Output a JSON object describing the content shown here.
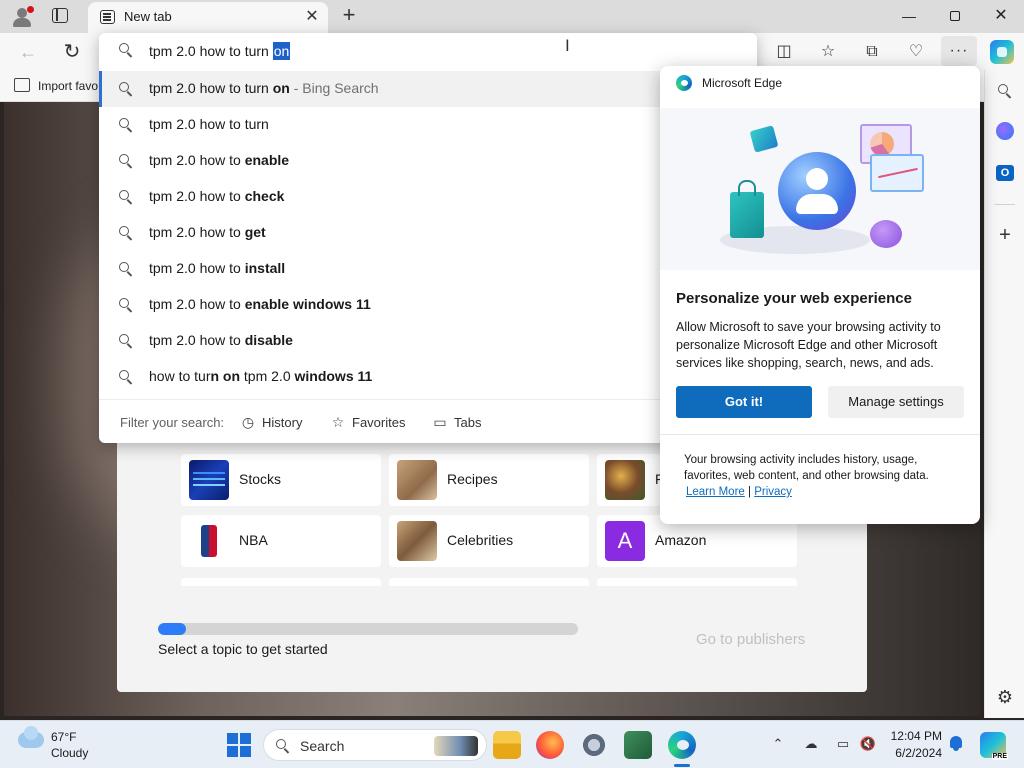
{
  "browser": {
    "tab_title": "New tab",
    "favorites_bar": {
      "import_label": "Import favo"
    }
  },
  "address_bar": {
    "typed_text": "tpm 2.0 how to turn ",
    "selected_completion": "on"
  },
  "suggestions": [
    {
      "prefix": "tpm 2.0 how to turn ",
      "bold": "on",
      "suffix": " - Bing Search",
      "active": true
    },
    {
      "prefix": "tpm 2.0 how to turn",
      "bold": "",
      "suffix": ""
    },
    {
      "prefix": "tpm 2.0 how to ",
      "bold": "enable",
      "suffix": ""
    },
    {
      "prefix": "tpm 2.0 how to ",
      "bold": "check",
      "suffix": ""
    },
    {
      "prefix": "tpm 2.0 how to ",
      "bold": "get",
      "suffix": ""
    },
    {
      "prefix": "tpm 2.0 how to ",
      "bold": "install",
      "suffix": ""
    },
    {
      "prefix": "tpm 2.0 how to ",
      "bold": "enable windows 11",
      "suffix": ""
    },
    {
      "prefix": "tpm 2.0 how to ",
      "bold": "disable",
      "suffix": ""
    },
    {
      "prefix": "how to tur",
      "bold": "n on",
      "mid": " tpm 2.0 ",
      "bold2": "windows 11",
      "suffix": ""
    }
  ],
  "filter": {
    "label": "Filter your search:",
    "chips": [
      "History",
      "Favorites",
      "Tabs"
    ]
  },
  "popup": {
    "header": "Microsoft Edge",
    "heading": "Personalize your web experience",
    "body": "Allow Microsoft to save your browsing activity to personalize Microsoft Edge and other Microsoft services like shopping, search, news, and ads.",
    "primary_button": "Got it!",
    "secondary_button": "Manage settings",
    "footer": "Your browsing activity includes history, usage, favorites, web content, and other browsing data.",
    "learn_more": "Learn More",
    "link_separator": "|",
    "privacy": "Privacy"
  },
  "content": {
    "tiles": [
      {
        "label": "Stocks",
        "thumb": "stocks"
      },
      {
        "label": "Recipes",
        "thumb": "recipes"
      },
      {
        "label": "F",
        "thumb": "food"
      },
      {
        "label": "NBA",
        "thumb": "nba"
      },
      {
        "label": "Celebrities",
        "thumb": "celeb"
      },
      {
        "label": "Amazon",
        "thumb": "amazon",
        "glyph": "A"
      }
    ],
    "progress_fraction": 0.066,
    "topic_message": "Select a topic to get started",
    "publishers_link": "Go to publishers"
  },
  "taskbar": {
    "weather_temp": "67°F",
    "weather_condition": "Cloudy",
    "search_placeholder": "Search",
    "time": "12:04 PM",
    "date": "6/2/2024",
    "copilot_badge": "PRE"
  },
  "colors": {
    "accent": "#0f6cbd",
    "selection": "#1e62c9",
    "progress": "#2f7df6",
    "amazon_tile": "#8a2be2"
  }
}
